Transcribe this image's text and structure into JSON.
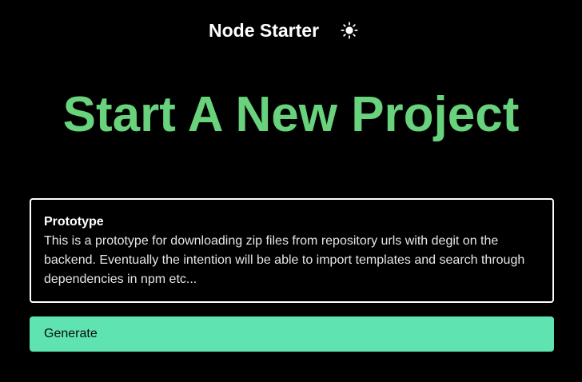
{
  "header": {
    "brand": "Node Starter",
    "theme_toggle_icon": "sun-icon"
  },
  "hero": {
    "title": "Start A New Project"
  },
  "card": {
    "title": "Prototype",
    "description": "This is a prototype for downloading zip files from repository urls with degit on the backend. Eventually the intention will be able to import templates and search through dependencies in npm etc..."
  },
  "actions": {
    "generate_label": "Generate"
  },
  "colors": {
    "background": "#000000",
    "hero_title": "#69d27c",
    "button_background": "#5ee3b1",
    "card_border": "#ffffff"
  }
}
